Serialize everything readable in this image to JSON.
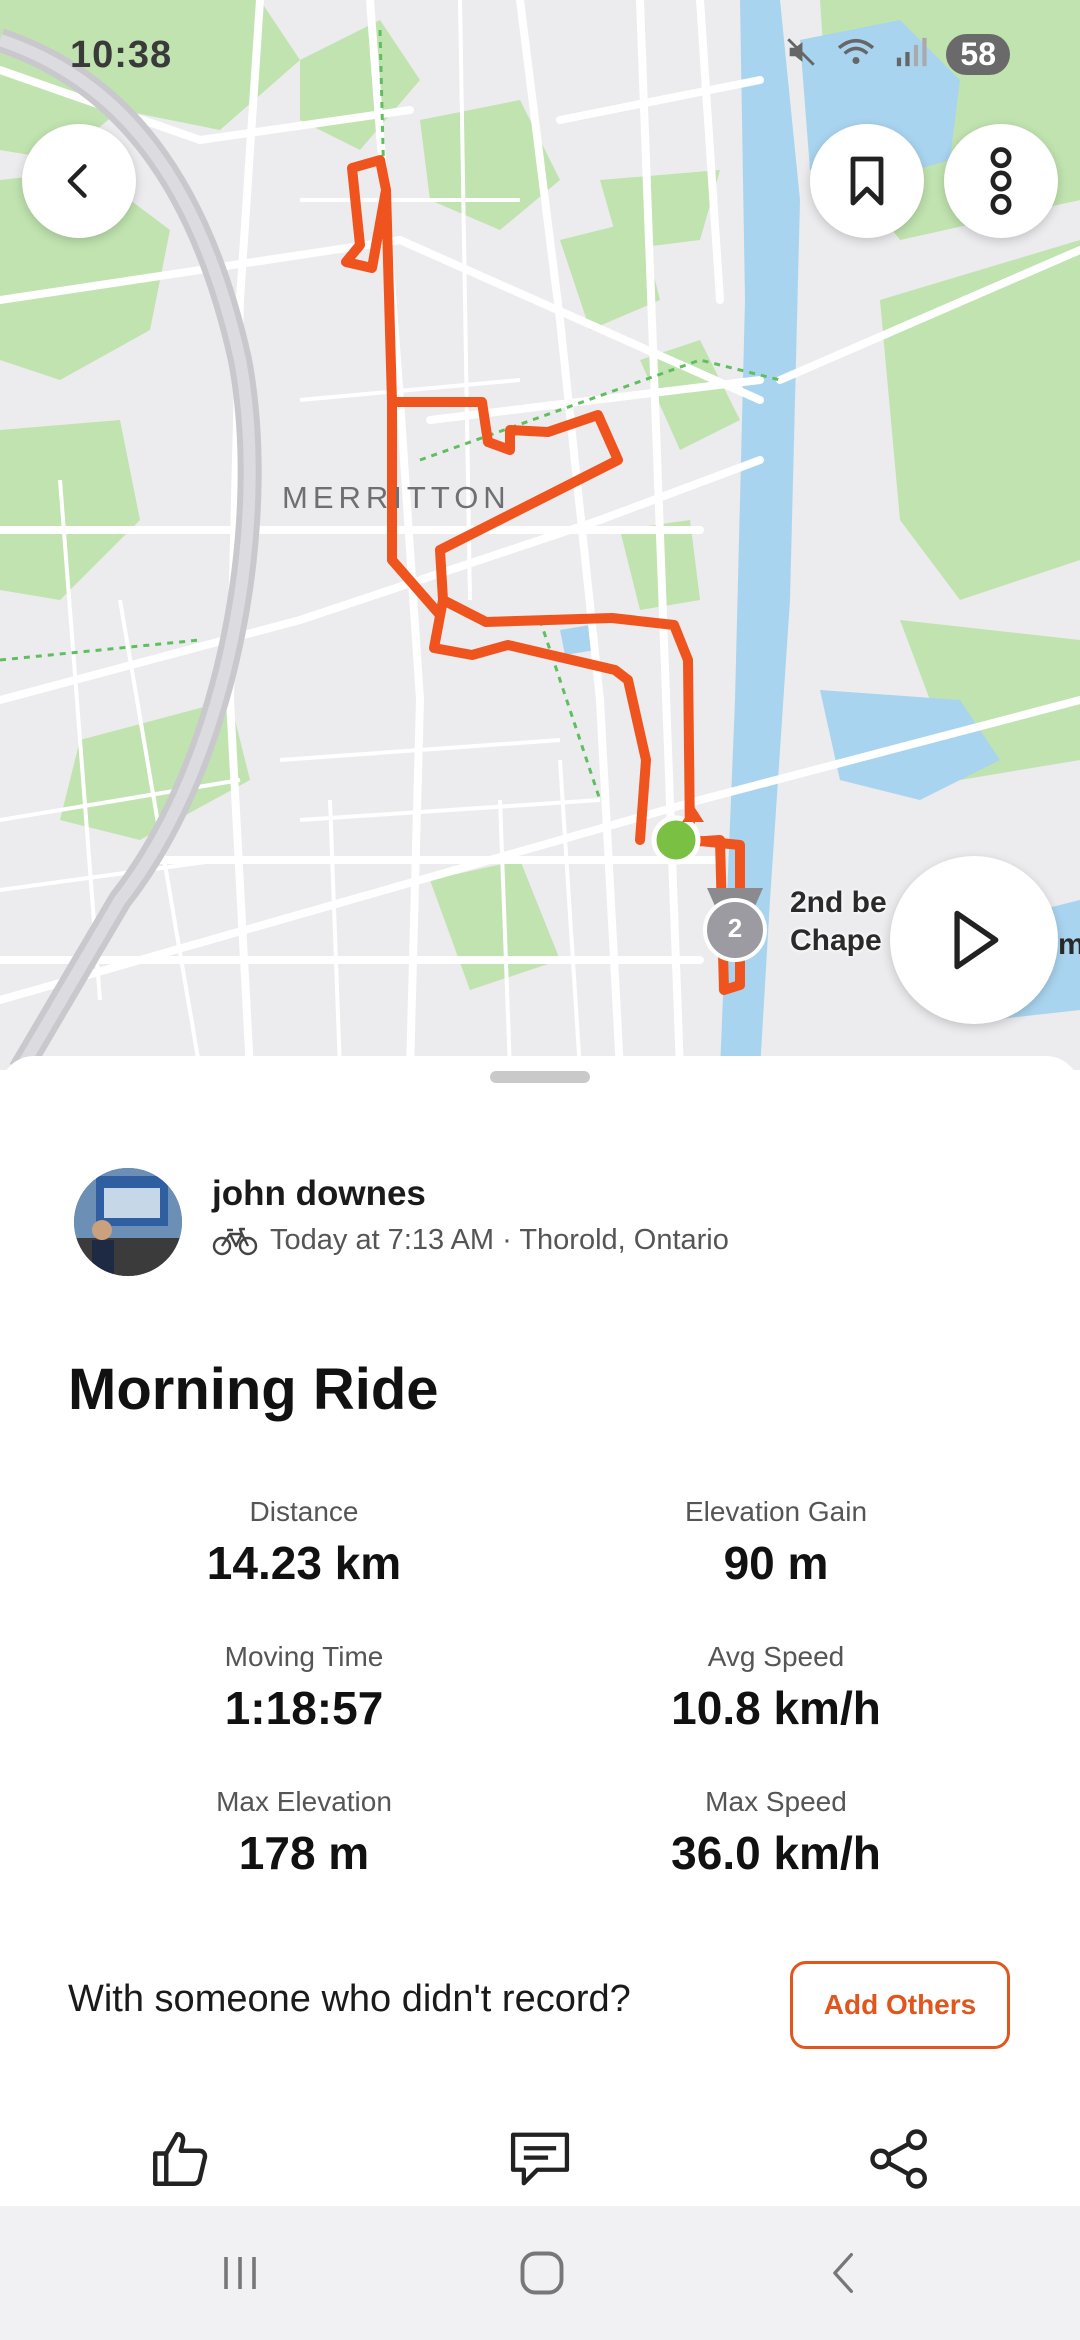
{
  "status_bar": {
    "time": "10:38",
    "battery": "58",
    "icons": [
      "mute-icon",
      "wifi-icon",
      "signal-icon"
    ]
  },
  "map": {
    "area_label": "MERRITTON",
    "segment_label_line1": "2nd be",
    "segment_label_line2": "Chape",
    "segment_label_cut": "m",
    "segment_rank": "2",
    "colors": {
      "route": "#f0541e",
      "start_marker": "#7ac143",
      "park": "#b9e2a5",
      "water": "#a9d4ef"
    }
  },
  "top_buttons": {
    "back_icon": "chevron-left-icon",
    "bookmark_icon": "bookmark-icon",
    "more_icon": "more-vertical-icon",
    "play_icon": "play-icon"
  },
  "athlete": {
    "name": "john downes",
    "meta": "Today at 7:13 AM · Thorold, Ontario",
    "activity_icon": "bicycle-icon"
  },
  "activity": {
    "title": "Morning Ride",
    "stats": [
      {
        "label": "Distance",
        "value": "14.23 km"
      },
      {
        "label": "Elevation Gain",
        "value": "90 m"
      },
      {
        "label": "Moving Time",
        "value": "1:18:57"
      },
      {
        "label": "Avg Speed",
        "value": "10.8 km/h"
      },
      {
        "label": "Max Elevation",
        "value": "178 m"
      },
      {
        "label": "Max Speed",
        "value": "36.0 km/h"
      }
    ]
  },
  "others": {
    "prompt": "With someone who didn't record?",
    "button_label": "Add Others",
    "accent": "#e0561d"
  },
  "actions": [
    "thumbs-up-icon",
    "comment-icon",
    "share-icon"
  ],
  "nav_bar": [
    "recents-icon",
    "home-icon",
    "back-icon"
  ]
}
